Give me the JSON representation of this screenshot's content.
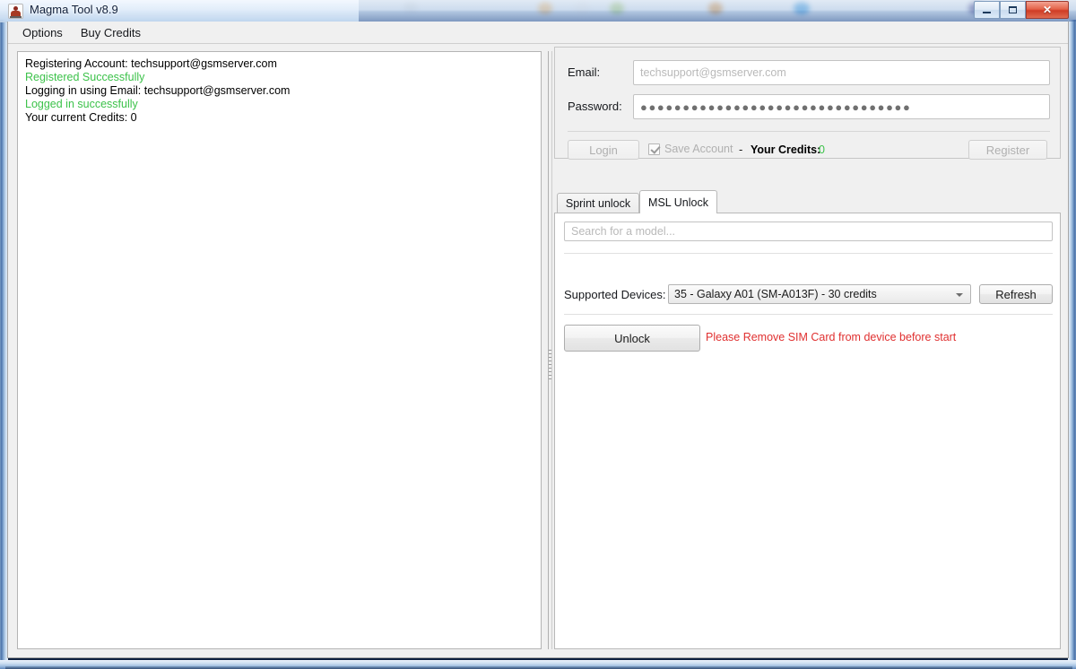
{
  "window": {
    "title": "Magma Tool v8.9",
    "icon": "app-icon",
    "controls": {
      "minimize": "–",
      "maximize": "□",
      "close": "✕"
    }
  },
  "menubar": {
    "items": [
      {
        "label": "Options"
      },
      {
        "label": "Buy Credits"
      }
    ]
  },
  "log": {
    "lines": [
      {
        "text": "Registering Account: techsupport@gsmserver.com",
        "status": "normal"
      },
      {
        "text": "Registered Successfully",
        "status": "ok"
      },
      {
        "text": "Logging in using Email: techsupport@gsmserver.com",
        "status": "normal"
      },
      {
        "text": "Logged in successfully",
        "status": "ok"
      },
      {
        "text": "Your current Credits: 0",
        "status": "normal"
      }
    ]
  },
  "account": {
    "email_label": "Email:",
    "email_value": "",
    "email_placeholder": "techsupport@gsmserver.com",
    "password_label": "Password:",
    "password_masked": "●●●●●●●●●●●●●●●●●●●●●●●●●●●●●●●●",
    "login_button": "Login",
    "save_account_label": "Save Account",
    "save_account_checked": true,
    "dash": "-",
    "credits_label": "Your Credits:",
    "credits_value": "0",
    "credits_color": "#3cc24a",
    "register_button": "Register"
  },
  "tabs": [
    {
      "label": "Sprint unlock",
      "active": false
    },
    {
      "label": "MSL Unlock",
      "active": true
    }
  ],
  "msl_panel": {
    "search_placeholder": "Search for a model...",
    "search_value": "",
    "supported_devices_label": "Supported Devices:",
    "selected_device": "35 - Galaxy A01 (SM-A013F) - 30 credits",
    "refresh_button": "Refresh",
    "unlock_button": "Unlock",
    "warning_text": "Please Remove SIM Card from device before start",
    "warning_color": "#e03030"
  }
}
